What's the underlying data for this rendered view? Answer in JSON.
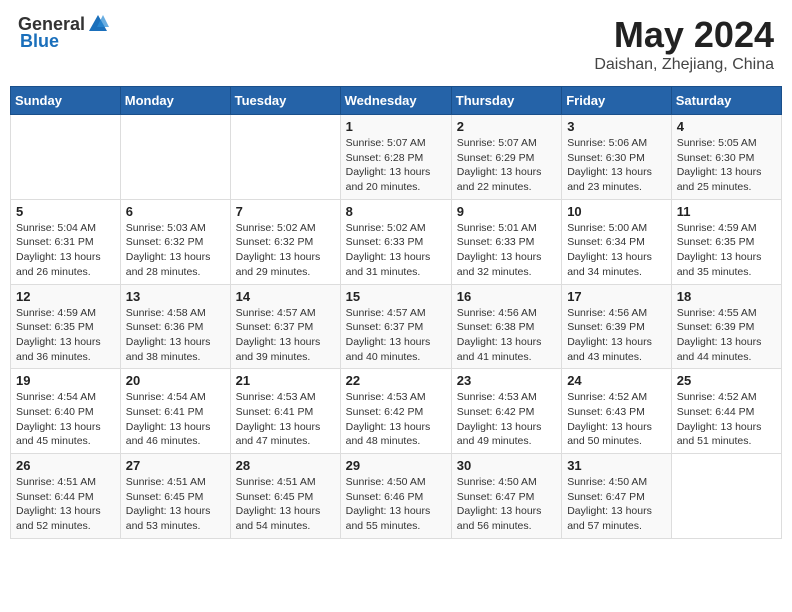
{
  "header": {
    "logo_general": "General",
    "logo_blue": "Blue",
    "title": "May 2024",
    "subtitle": "Daishan, Zhejiang, China"
  },
  "days_of_week": [
    "Sunday",
    "Monday",
    "Tuesday",
    "Wednesday",
    "Thursday",
    "Friday",
    "Saturday"
  ],
  "weeks": [
    [
      {
        "day": "",
        "info": ""
      },
      {
        "day": "",
        "info": ""
      },
      {
        "day": "",
        "info": ""
      },
      {
        "day": "1",
        "info": "Sunrise: 5:07 AM\nSunset: 6:28 PM\nDaylight: 13 hours\nand 20 minutes."
      },
      {
        "day": "2",
        "info": "Sunrise: 5:07 AM\nSunset: 6:29 PM\nDaylight: 13 hours\nand 22 minutes."
      },
      {
        "day": "3",
        "info": "Sunrise: 5:06 AM\nSunset: 6:30 PM\nDaylight: 13 hours\nand 23 minutes."
      },
      {
        "day": "4",
        "info": "Sunrise: 5:05 AM\nSunset: 6:30 PM\nDaylight: 13 hours\nand 25 minutes."
      }
    ],
    [
      {
        "day": "5",
        "info": "Sunrise: 5:04 AM\nSunset: 6:31 PM\nDaylight: 13 hours\nand 26 minutes."
      },
      {
        "day": "6",
        "info": "Sunrise: 5:03 AM\nSunset: 6:32 PM\nDaylight: 13 hours\nand 28 minutes."
      },
      {
        "day": "7",
        "info": "Sunrise: 5:02 AM\nSunset: 6:32 PM\nDaylight: 13 hours\nand 29 minutes."
      },
      {
        "day": "8",
        "info": "Sunrise: 5:02 AM\nSunset: 6:33 PM\nDaylight: 13 hours\nand 31 minutes."
      },
      {
        "day": "9",
        "info": "Sunrise: 5:01 AM\nSunset: 6:33 PM\nDaylight: 13 hours\nand 32 minutes."
      },
      {
        "day": "10",
        "info": "Sunrise: 5:00 AM\nSunset: 6:34 PM\nDaylight: 13 hours\nand 34 minutes."
      },
      {
        "day": "11",
        "info": "Sunrise: 4:59 AM\nSunset: 6:35 PM\nDaylight: 13 hours\nand 35 minutes."
      }
    ],
    [
      {
        "day": "12",
        "info": "Sunrise: 4:59 AM\nSunset: 6:35 PM\nDaylight: 13 hours\nand 36 minutes."
      },
      {
        "day": "13",
        "info": "Sunrise: 4:58 AM\nSunset: 6:36 PM\nDaylight: 13 hours\nand 38 minutes."
      },
      {
        "day": "14",
        "info": "Sunrise: 4:57 AM\nSunset: 6:37 PM\nDaylight: 13 hours\nand 39 minutes."
      },
      {
        "day": "15",
        "info": "Sunrise: 4:57 AM\nSunset: 6:37 PM\nDaylight: 13 hours\nand 40 minutes."
      },
      {
        "day": "16",
        "info": "Sunrise: 4:56 AM\nSunset: 6:38 PM\nDaylight: 13 hours\nand 41 minutes."
      },
      {
        "day": "17",
        "info": "Sunrise: 4:56 AM\nSunset: 6:39 PM\nDaylight: 13 hours\nand 43 minutes."
      },
      {
        "day": "18",
        "info": "Sunrise: 4:55 AM\nSunset: 6:39 PM\nDaylight: 13 hours\nand 44 minutes."
      }
    ],
    [
      {
        "day": "19",
        "info": "Sunrise: 4:54 AM\nSunset: 6:40 PM\nDaylight: 13 hours\nand 45 minutes."
      },
      {
        "day": "20",
        "info": "Sunrise: 4:54 AM\nSunset: 6:41 PM\nDaylight: 13 hours\nand 46 minutes."
      },
      {
        "day": "21",
        "info": "Sunrise: 4:53 AM\nSunset: 6:41 PM\nDaylight: 13 hours\nand 47 minutes."
      },
      {
        "day": "22",
        "info": "Sunrise: 4:53 AM\nSunset: 6:42 PM\nDaylight: 13 hours\nand 48 minutes."
      },
      {
        "day": "23",
        "info": "Sunrise: 4:53 AM\nSunset: 6:42 PM\nDaylight: 13 hours\nand 49 minutes."
      },
      {
        "day": "24",
        "info": "Sunrise: 4:52 AM\nSunset: 6:43 PM\nDaylight: 13 hours\nand 50 minutes."
      },
      {
        "day": "25",
        "info": "Sunrise: 4:52 AM\nSunset: 6:44 PM\nDaylight: 13 hours\nand 51 minutes."
      }
    ],
    [
      {
        "day": "26",
        "info": "Sunrise: 4:51 AM\nSunset: 6:44 PM\nDaylight: 13 hours\nand 52 minutes."
      },
      {
        "day": "27",
        "info": "Sunrise: 4:51 AM\nSunset: 6:45 PM\nDaylight: 13 hours\nand 53 minutes."
      },
      {
        "day": "28",
        "info": "Sunrise: 4:51 AM\nSunset: 6:45 PM\nDaylight: 13 hours\nand 54 minutes."
      },
      {
        "day": "29",
        "info": "Sunrise: 4:50 AM\nSunset: 6:46 PM\nDaylight: 13 hours\nand 55 minutes."
      },
      {
        "day": "30",
        "info": "Sunrise: 4:50 AM\nSunset: 6:47 PM\nDaylight: 13 hours\nand 56 minutes."
      },
      {
        "day": "31",
        "info": "Sunrise: 4:50 AM\nSunset: 6:47 PM\nDaylight: 13 hours\nand 57 minutes."
      },
      {
        "day": "",
        "info": ""
      }
    ]
  ]
}
